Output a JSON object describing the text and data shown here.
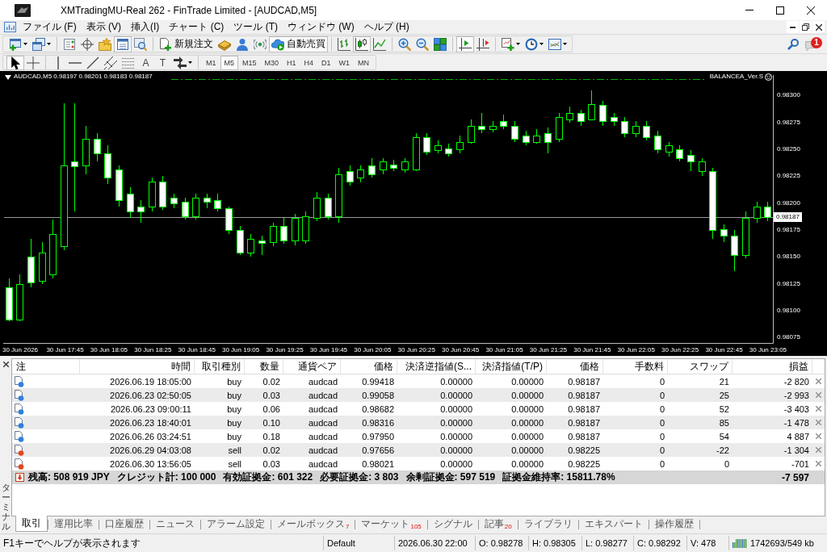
{
  "window": {
    "title": "XMTradingMU-Real 262 - FinTrade Limited - [AUDCAD,M5]"
  },
  "menu": [
    "ファイル (F)",
    "表示 (V)",
    "挿入(I)",
    "チャート (C)",
    "ツール (T)",
    "ウィンドウ (W)",
    "ヘルプ (H)"
  ],
  "toolbar": {
    "groups": [
      [
        {
          "pressed": false
        },
        {
          "pressed": false
        }
      ],
      [
        {
          "pressed": false
        },
        {
          "pressed": false
        },
        {
          "pressed": false
        },
        {
          "pressed": true
        },
        {
          "pressed": false
        }
      ],
      [
        {
          "label": "新規注文",
          "pressed": false
        },
        {
          "pressed": false
        },
        {
          "pressed": false
        },
        {
          "pressed": false
        },
        {
          "label": "自動売買",
          "pressed": true
        }
      ],
      [
        {
          "pressed": false
        },
        {
          "pressed": true
        },
        {
          "pressed": false
        }
      ],
      [
        {
          "pressed": false
        },
        {
          "pressed": false
        },
        {
          "pressed": false
        }
      ],
      [
        {
          "pressed": true
        },
        {
          "pressed": false
        }
      ],
      [
        {
          "pressed": false
        },
        {
          "pressed": false
        },
        {
          "pressed": false
        }
      ]
    ]
  },
  "notifications": {
    "count": "1"
  },
  "drawing_toolbar": {
    "groups": [
      [
        {
          "pressed": true
        },
        {
          "pressed": false
        }
      ],
      [
        {
          "pressed": false
        },
        {
          "pressed": false
        },
        {
          "pressed": false
        },
        {
          "pressed": false
        },
        {
          "pressed": false
        },
        {
          "label": "A",
          "pressed": false
        },
        {
          "label": "T",
          "pressed": false
        },
        {
          "pressed": false
        }
      ]
    ]
  },
  "timeframes": [
    {
      "label": "M1",
      "selected": false
    },
    {
      "label": "M5",
      "selected": true
    },
    {
      "label": "M15",
      "selected": false
    },
    {
      "label": "M30",
      "selected": false
    },
    {
      "label": "H1",
      "selected": false
    },
    {
      "label": "H4",
      "selected": false
    },
    {
      "label": "D1",
      "selected": false
    },
    {
      "label": "W1",
      "selected": false
    },
    {
      "label": "MN",
      "selected": false
    }
  ],
  "chart": {
    "header": "AUDCAD,M5 0.98197 0.98201 0.98183 0.98187",
    "expert": "BALANCEA_Ver.S",
    "current_price": "0.98187",
    "chart_data": {
      "type": "candlestick",
      "ylim": [
        0.9807,
        0.98319
      ],
      "yticks": [
        {
          "value": 0.983,
          "label": "0.98300"
        },
        {
          "value": 0.98275,
          "label": "0.98275"
        },
        {
          "value": 0.9825,
          "label": "0.98250"
        },
        {
          "value": 0.98225,
          "label": "0.98225"
        },
        {
          "value": 0.982,
          "label": "0.98200"
        },
        {
          "value": 0.98175,
          "label": "0.98175"
        },
        {
          "value": 0.9815,
          "label": "0.98150"
        },
        {
          "value": 0.98125,
          "label": "0.98125"
        },
        {
          "value": 0.981,
          "label": "0.98100"
        },
        {
          "value": 0.98075,
          "label": "0.98075"
        }
      ],
      "ohlc": [
        [
          0.98122,
          0.9813,
          0.9809,
          0.98092
        ],
        [
          0.98092,
          0.98134,
          0.9809,
          0.98125
        ],
        [
          0.9815,
          0.98167,
          0.98122,
          0.98126
        ],
        [
          0.98128,
          0.98164,
          0.98125,
          0.98154
        ],
        [
          0.98134,
          0.98185,
          0.9813,
          0.98171
        ],
        [
          0.9816,
          0.98293,
          0.98156,
          0.98235
        ],
        [
          0.98239,
          0.98293,
          0.98192,
          0.98234
        ],
        [
          0.98235,
          0.98272,
          0.98227,
          0.9826
        ],
        [
          0.9826,
          0.98265,
          0.98239,
          0.98246
        ],
        [
          0.98246,
          0.98254,
          0.98218,
          0.98224
        ],
        [
          0.98231,
          0.98235,
          0.98197,
          0.98203
        ],
        [
          0.98209,
          0.98215,
          0.98186,
          0.98192
        ],
        [
          0.98197,
          0.98203,
          0.98182,
          0.98192
        ],
        [
          0.98197,
          0.98224,
          0.98192,
          0.9822
        ],
        [
          0.9822,
          0.98225,
          0.98194,
          0.98197
        ],
        [
          0.98205,
          0.98209,
          0.98195,
          0.982
        ],
        [
          0.98201,
          0.98205,
          0.98185,
          0.98188
        ],
        [
          0.98188,
          0.98209,
          0.98185,
          0.98205
        ],
        [
          0.98205,
          0.98209,
          0.98195,
          0.98201
        ],
        [
          0.98203,
          0.98209,
          0.98192,
          0.98195
        ],
        [
          0.98195,
          0.98197,
          0.98171,
          0.98175
        ],
        [
          0.98175,
          0.98179,
          0.98152,
          0.98154
        ],
        [
          0.98154,
          0.98171,
          0.9815,
          0.98167
        ],
        [
          0.98165,
          0.9817,
          0.98152,
          0.98163
        ],
        [
          0.98164,
          0.98182,
          0.9816,
          0.98179
        ],
        [
          0.98179,
          0.98186,
          0.98162,
          0.98165
        ],
        [
          0.98165,
          0.9819,
          0.98161,
          0.98186
        ],
        [
          0.98165,
          0.98192,
          0.98162,
          0.98188
        ],
        [
          0.98186,
          0.9821,
          0.98183,
          0.98205
        ],
        [
          0.98205,
          0.98209,
          0.98185,
          0.98188
        ],
        [
          0.98188,
          0.98233,
          0.98182,
          0.98227
        ],
        [
          0.9823,
          0.98235,
          0.98216,
          0.9822
        ],
        [
          0.98224,
          0.98235,
          0.98219,
          0.98231
        ],
        [
          0.98235,
          0.98242,
          0.98224,
          0.98227
        ],
        [
          0.98231,
          0.98242,
          0.98227,
          0.98239
        ],
        [
          0.98236,
          0.9824,
          0.9823,
          0.98233
        ],
        [
          0.98231,
          0.98242,
          0.98228,
          0.98239
        ],
        [
          0.98231,
          0.98265,
          0.9823,
          0.98261
        ],
        [
          0.98261,
          0.98265,
          0.98245,
          0.98248
        ],
        [
          0.98249,
          0.98258,
          0.98246,
          0.98254
        ],
        [
          0.98251,
          0.98255,
          0.98243,
          0.98246
        ],
        [
          0.9825,
          0.98263,
          0.98246,
          0.98257
        ],
        [
          0.98257,
          0.98278,
          0.98255,
          0.98272
        ],
        [
          0.98272,
          0.98284,
          0.98265,
          0.98269
        ],
        [
          0.98269,
          0.98276,
          0.98266,
          0.98272
        ],
        [
          0.98276,
          0.98282,
          0.98269,
          0.98272
        ],
        [
          0.98272,
          0.98276,
          0.98257,
          0.9826
        ],
        [
          0.98263,
          0.98267,
          0.98254,
          0.98257
        ],
        [
          0.98257,
          0.98269,
          0.98255,
          0.98263
        ],
        [
          0.98265,
          0.9827,
          0.98246,
          0.98257
        ],
        [
          0.9826,
          0.98284,
          0.98257,
          0.9828
        ],
        [
          0.98278,
          0.9829,
          0.98275,
          0.98284
        ],
        [
          0.98284,
          0.98287,
          0.98272,
          0.98276
        ],
        [
          0.98278,
          0.98305,
          0.98277,
          0.98292
        ],
        [
          0.98291,
          0.98295,
          0.98272,
          0.98276
        ],
        [
          0.9828,
          0.98284,
          0.98272,
          0.98276
        ],
        [
          0.98276,
          0.9828,
          0.98261,
          0.98265
        ],
        [
          0.98265,
          0.98276,
          0.98261,
          0.98272
        ],
        [
          0.98272,
          0.98276,
          0.98258,
          0.98261
        ],
        [
          0.98263,
          0.98267,
          0.98246,
          0.9825
        ],
        [
          0.98248,
          0.98257,
          0.98243,
          0.98254
        ],
        [
          0.9825,
          0.98254,
          0.98239,
          0.98242
        ],
        [
          0.98245,
          0.98249,
          0.9823,
          0.98239
        ],
        [
          0.9823,
          0.98242,
          0.98225,
          0.98239
        ],
        [
          0.9823,
          0.98233,
          0.98167,
          0.98175
        ],
        [
          0.98176,
          0.9818,
          0.98164,
          0.9817
        ],
        [
          0.9817,
          0.98175,
          0.98137,
          0.98152
        ],
        [
          0.98152,
          0.98192,
          0.98149,
          0.98186
        ],
        [
          0.98186,
          0.98201,
          0.98182,
          0.98197
        ],
        [
          0.98197,
          0.98201,
          0.98183,
          0.98187
        ]
      ]
    },
    "time_axis": [
      "30 Jun 2026",
      "30 Jun 17:45",
      "30 Jun 18:05",
      "30 Jun 18:25",
      "30 Jun 18:45",
      "30 Jun 19:05",
      "30 Jun 19:25",
      "30 Jun 19:45",
      "30 Jun 20:05",
      "30 Jun 20:25",
      "30 Jun 20:45",
      "30 Jun 21:05",
      "30 Jun 21:25",
      "30 Jun 21:45",
      "30 Jun 22:05",
      "30 Jun 22:25",
      "30 Jun 22:45",
      "30 Jun 23:05"
    ]
  },
  "terminal": {
    "side_label": "ターミナル",
    "columns": [
      "注",
      "時間",
      "取引種別",
      "数量",
      "通貨ペア",
      "価格",
      "決済逆指値(S...",
      "決済指値(T/P)",
      "価格",
      "手数料",
      "スワップ",
      "損益"
    ],
    "rows": [
      {
        "kind": "buy",
        "time": "2026.06.19 18:05:00",
        "type": "buy",
        "volume": "0.02",
        "symbol": "audcad",
        "open_price": "0.99418",
        "stop_loss": "0.00000",
        "take_profit": "0.00000",
        "price": "0.98187",
        "commission": "0",
        "swap": "21",
        "profit": "-2 820"
      },
      {
        "kind": "buy",
        "time": "2026.06.23 02:50:05",
        "type": "buy",
        "volume": "0.03",
        "symbol": "audcad",
        "open_price": "0.99058",
        "stop_loss": "0.00000",
        "take_profit": "0.00000",
        "price": "0.98187",
        "commission": "0",
        "swap": "25",
        "profit": "-2 993"
      },
      {
        "kind": "buy",
        "time": "2026.06.23 09:00:11",
        "type": "buy",
        "volume": "0.06",
        "symbol": "audcad",
        "open_price": "0.98682",
        "stop_loss": "0.00000",
        "take_profit": "0.00000",
        "price": "0.98187",
        "commission": "0",
        "swap": "52",
        "profit": "-3 403"
      },
      {
        "kind": "buy",
        "time": "2026.06.23 18:40:01",
        "type": "buy",
        "volume": "0.10",
        "symbol": "audcad",
        "open_price": "0.98316",
        "stop_loss": "0.00000",
        "take_profit": "0.00000",
        "price": "0.98187",
        "commission": "0",
        "swap": "85",
        "profit": "-1 478"
      },
      {
        "kind": "buy",
        "time": "2026.06.26 03:24:51",
        "type": "buy",
        "volume": "0.18",
        "symbol": "audcad",
        "open_price": "0.97950",
        "stop_loss": "0.00000",
        "take_profit": "0.00000",
        "price": "0.98187",
        "commission": "0",
        "swap": "54",
        "profit": "4 887"
      },
      {
        "kind": "sell",
        "time": "2026.06.29 04:03:08",
        "type": "sell",
        "volume": "0.02",
        "symbol": "audcad",
        "open_price": "0.97656",
        "stop_loss": "0.00000",
        "take_profit": "0.00000",
        "price": "0.98225",
        "commission": "0",
        "swap": "-22",
        "profit": "-1 304"
      },
      {
        "kind": "sell",
        "time": "2026.06.30 13:56:05",
        "type": "sell",
        "volume": "0.03",
        "symbol": "audcad",
        "open_price": "0.98021",
        "stop_loss": "0.00000",
        "take_profit": "0.00000",
        "price": "0.98225",
        "commission": "0",
        "swap": "0",
        "profit": "-701"
      }
    ],
    "summary": {
      "items": [
        "残高: 508 919 JPY",
        "クレジット計: 100 000",
        "有効証拠金: 601 322",
        "必要証拠金: 3 803",
        "余剰証拠金: 597 519",
        "証拠金維持率: 15811.78%"
      ],
      "profit": "-7 597"
    },
    "tabs": [
      {
        "label": "取引",
        "selected": true
      },
      {
        "label": "運用比率",
        "selected": false
      },
      {
        "label": "口座履歴",
        "selected": false
      },
      {
        "label": "ニュース",
        "selected": false
      },
      {
        "label": "アラーム設定",
        "selected": false
      },
      {
        "label": "メールボックス",
        "badge": "7",
        "selected": false
      },
      {
        "label": "マーケット",
        "badge": "105",
        "selected": false
      },
      {
        "label": "シグナル",
        "selected": false
      },
      {
        "label": "記事",
        "badge": "20",
        "selected": false
      },
      {
        "label": "ライブラリ",
        "selected": false
      },
      {
        "label": "エキスパート",
        "selected": false
      },
      {
        "label": "操作履歴",
        "selected": false
      }
    ]
  },
  "status_bar": {
    "help": "F1キーでヘルプが表示されます",
    "profile": "Default",
    "datetime": "2026.06.30 22:00",
    "open": "O: 0.98278",
    "high": "H: 0.98305",
    "low": "L: 0.98277",
    "close": "C: 0.98292",
    "volume": "V: 478",
    "traffic": "1742693/549 kb"
  }
}
